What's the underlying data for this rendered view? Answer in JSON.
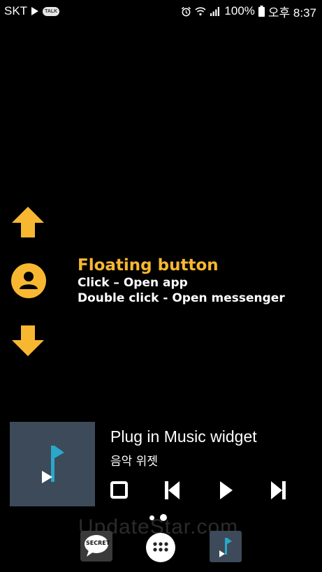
{
  "status_bar": {
    "carrier": "SKT",
    "talk_badge": "TALK",
    "battery": "100%",
    "time": "오후 8:37"
  },
  "floating_hint": {
    "title": "Floating button",
    "line1": "Click – Open app",
    "line2": "Double click  - Open messenger"
  },
  "widget": {
    "title": "Plug in Music widget",
    "subtitle": "음악 위젯"
  },
  "watermark": "UpdateStar.com",
  "dock": {
    "secret_label": "SECRET"
  },
  "colors": {
    "accent": "#f7b731",
    "widget_bg": "#3d4a59",
    "note": "#29a8c9"
  }
}
